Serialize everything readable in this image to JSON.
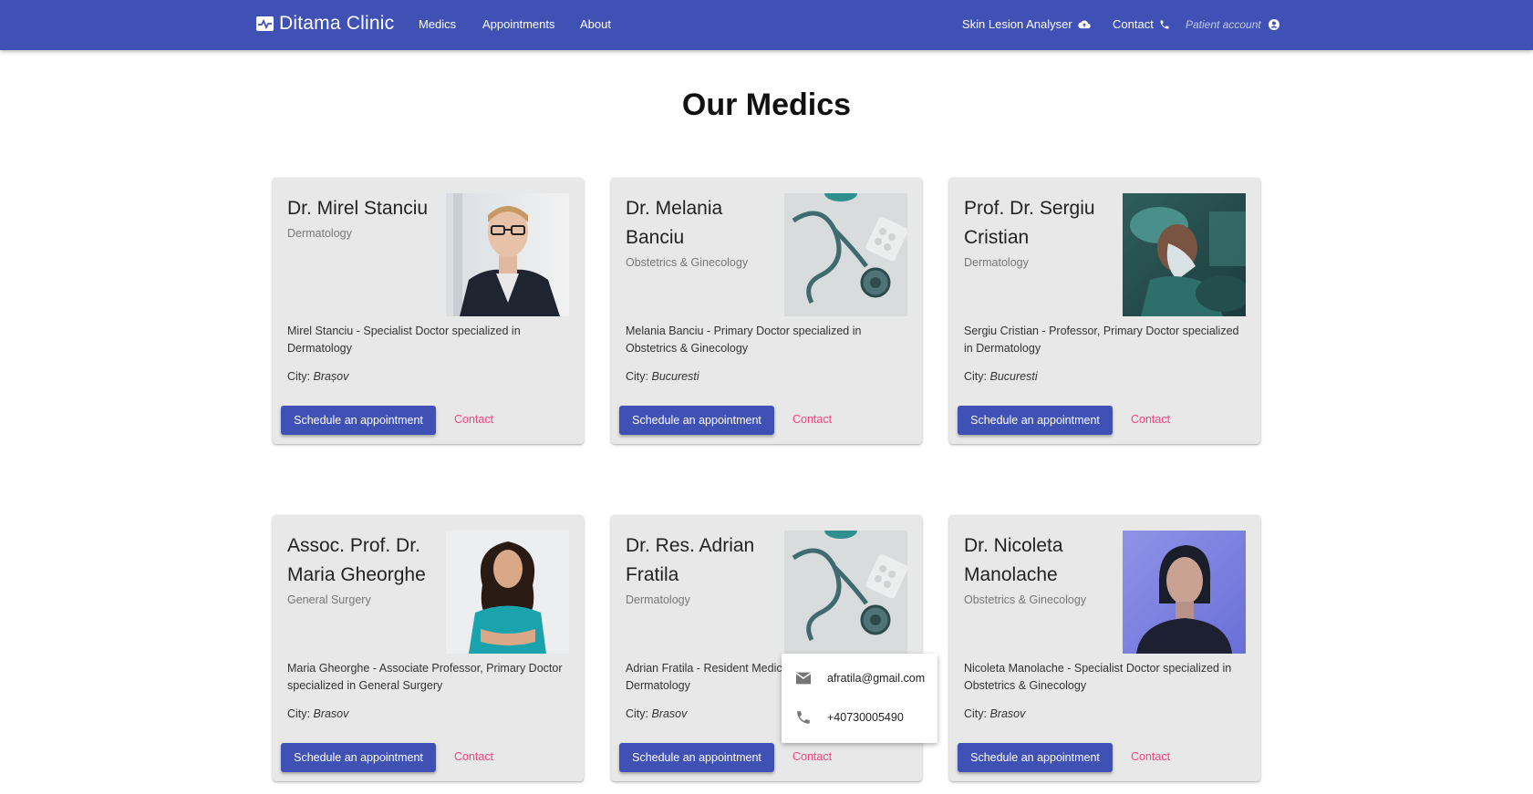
{
  "nav": {
    "brand": "Ditama Clinic",
    "links": [
      "Medics",
      "Appointments",
      "About"
    ],
    "skin_lesion": "Skin Lesion Analyser",
    "contact": "Contact",
    "account": "Patient account"
  },
  "page_title": "Our Medics",
  "colors": {
    "primary": "#3f51b5",
    "accent": "#ff4081",
    "card_bg": "#e8e8e8"
  },
  "cards": [
    {
      "name": "Dr. Mirel Stanciu",
      "specialty": "Dermatology",
      "description": "Mirel Stanciu - Specialist Doctor specialized in Dermatology",
      "city_label": "City:",
      "city": "Brașov",
      "image": "man-glasses-portrait",
      "button": "Schedule an appointment",
      "contact": "Contact"
    },
    {
      "name": "Dr. Melania Banciu",
      "specialty": "Obstetrics & Ginecology",
      "description": "Melania Banciu - Primary Doctor specialized in Obstetrics & Ginecology",
      "city_label": "City:",
      "city": "Bucuresti",
      "image": "stethoscope-photo",
      "button": "Schedule an appointment",
      "contact": "Contact"
    },
    {
      "name": "Prof. Dr. Sergiu Cristian",
      "specialty": "Dermatology",
      "description": "Sergiu Cristian - Professor, Primary Doctor specialized in Dermatology",
      "city_label": "City:",
      "city": "Bucuresti",
      "image": "surgeon-photo",
      "button": "Schedule an appointment",
      "contact": "Contact"
    },
    {
      "name": "Assoc. Prof. Dr. Maria Gheorghe",
      "specialty": "General Surgery",
      "description": "Maria Gheorghe - Associate Professor, Primary Doctor specialized in General Surgery",
      "city_label": "City:",
      "city": "Brasov",
      "image": "woman-scrubs-portrait",
      "button": "Schedule an appointment",
      "contact": "Contact"
    },
    {
      "name": "Dr. Res. Adrian Fratila",
      "specialty": "Dermatology",
      "description": "Adrian Fratila - Resident Medic",
      "description_line2": "Dermatology",
      "city_label": "City:",
      "city": "Brasov",
      "image": "stethoscope-photo",
      "button": "Schedule an appointment",
      "contact": "Contact"
    },
    {
      "name": "Dr. Nicoleta Manolache",
      "specialty": "Obstetrics & Ginecology",
      "description": "Nicoleta Manolache - Specialist Doctor specialized in Obstetrics & Ginecology",
      "city_label": "City:",
      "city": "Brasov",
      "image": "woman-portrait-blue",
      "button": "Schedule an appointment",
      "contact": "Contact"
    }
  ],
  "contact_popup": {
    "email": "afratila@gmail.com",
    "phone": "+40730005490"
  }
}
